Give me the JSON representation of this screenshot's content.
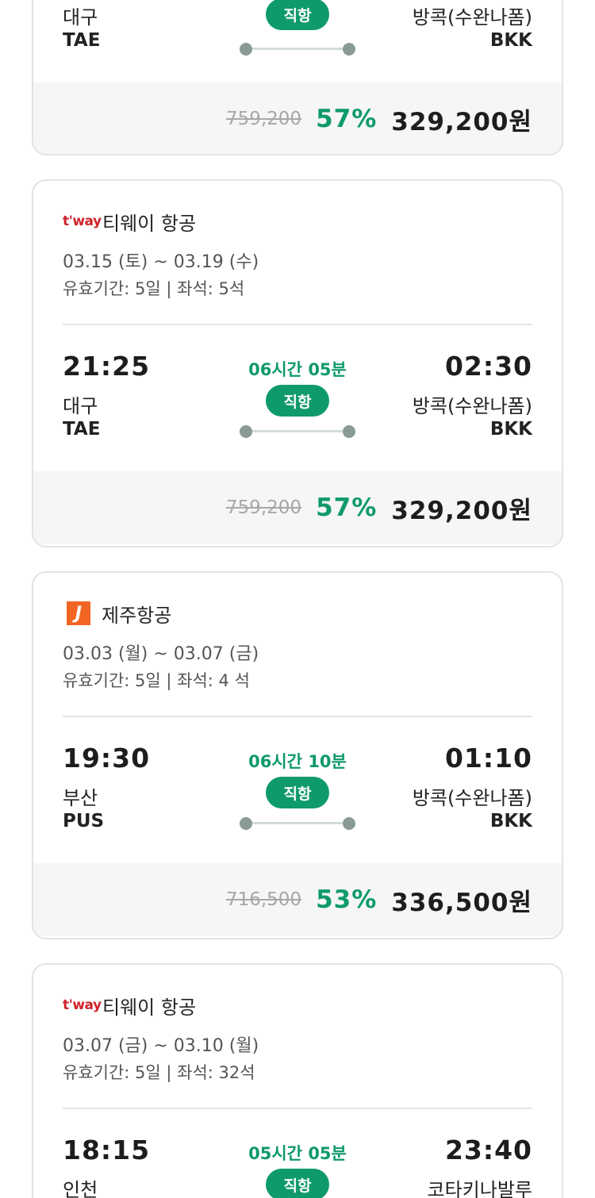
{
  "cards": [
    {
      "dep_city": "대구",
      "dep_code": "TAE",
      "badge": "직항",
      "arr_city": "방콕(수완나폼)",
      "arr_code": "BKK",
      "orig_price": "759,200",
      "discount": "57%",
      "price": "329,200원"
    },
    {
      "airline_logo": "t'way",
      "airline": "티웨이 항공",
      "dates": "03.15 (토) ~ 03.19 (수)",
      "validity": "유효기간: 5일 | 좌석: 5석",
      "dep_time": "21:25",
      "dep_city": "대구",
      "dep_code": "TAE",
      "duration": "06시간 05분",
      "badge": "직항",
      "arr_time": "02:30",
      "arr_city": "방콕(수완나폼)",
      "arr_code": "BKK",
      "orig_price": "759,200",
      "discount": "57%",
      "price": "329,200원"
    },
    {
      "airline_logo": "J",
      "airline": "제주항공",
      "dates": "03.03 (월) ~ 03.07 (금)",
      "validity": "유효기간: 5일 | 좌석: 4 석",
      "dep_time": "19:30",
      "dep_city": "부산",
      "dep_code": "PUS",
      "duration": "06시간 10분",
      "badge": "직항",
      "arr_time": "01:10",
      "arr_city": "방콕(수완나폼)",
      "arr_code": "BKK",
      "orig_price": "716,500",
      "discount": "53%",
      "price": "336,500원"
    },
    {
      "airline_logo": "t'way",
      "airline": "티웨이 항공",
      "dates": "03.07 (금) ~ 03.10 (월)",
      "validity": "유효기간: 5일 | 좌석: 32석",
      "dep_time": "18:15",
      "dep_city": "인천",
      "duration": "05시간 05분",
      "badge": "직항",
      "arr_time": "23:40",
      "arr_city": "코타키나발루"
    }
  ],
  "colors": {
    "accent": "#0f9a6c",
    "tway": "#d1232a",
    "jeju": "#f26522"
  }
}
